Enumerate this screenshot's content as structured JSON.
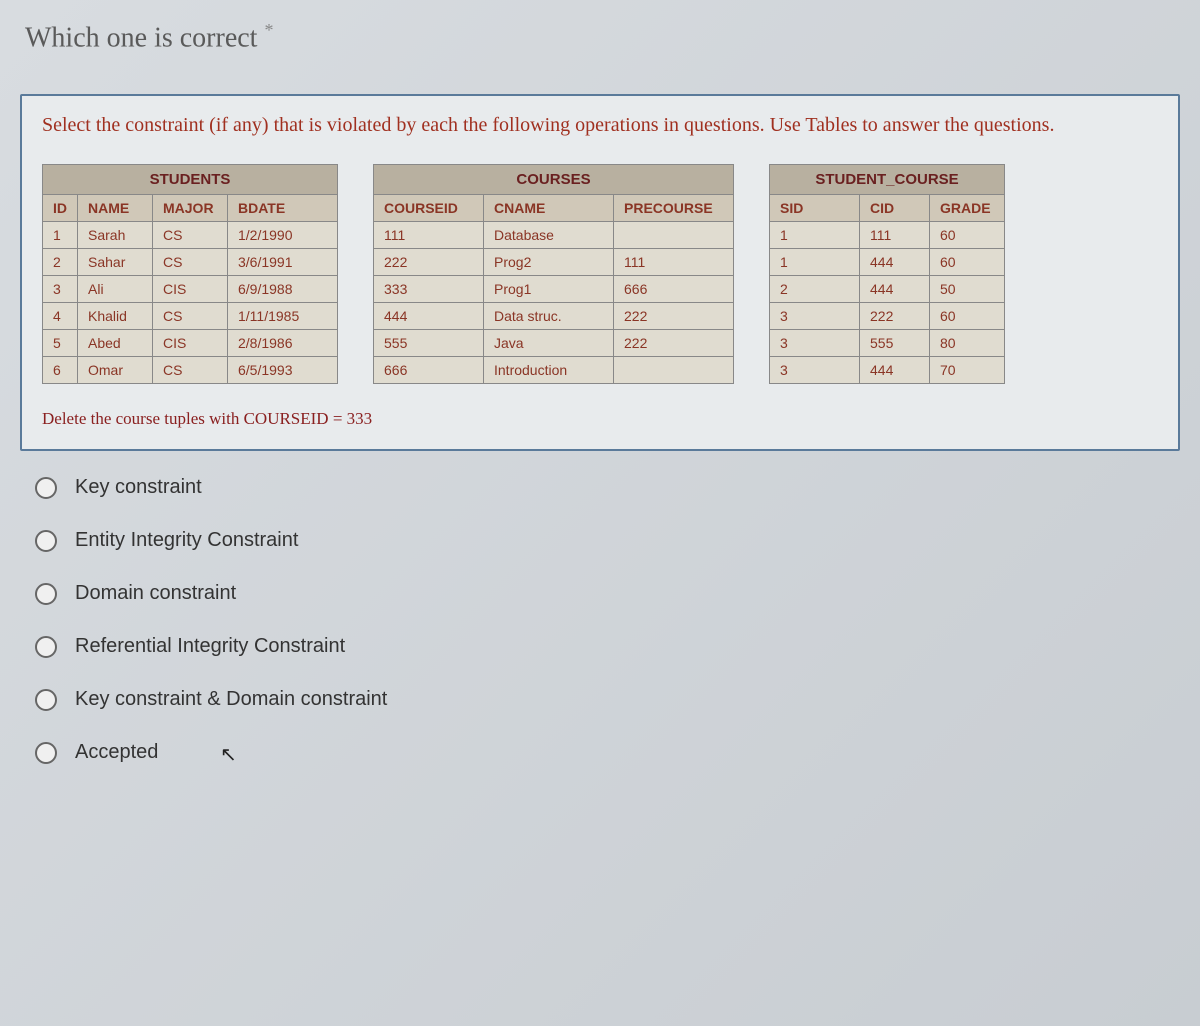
{
  "title": "Which one is correct",
  "instruction": "Select the constraint (if any) that is violated by each the following operations in questions. Use Tables to answer the questions.",
  "tables": {
    "students": {
      "title": "STUDENTS",
      "headers": [
        "ID",
        "NAME",
        "MAJOR",
        "BDATE"
      ],
      "rows": [
        [
          "1",
          "Sarah",
          "CS",
          "1/2/1990"
        ],
        [
          "2",
          "Sahar",
          "CS",
          "3/6/1991"
        ],
        [
          "3",
          "Ali",
          "CIS",
          "6/9/1988"
        ],
        [
          "4",
          "Khalid",
          "CS",
          "1/11/1985"
        ],
        [
          "5",
          "Abed",
          "CIS",
          "2/8/1986"
        ],
        [
          "6",
          "Omar",
          "CS",
          "6/5/1993"
        ]
      ]
    },
    "courses": {
      "title": "COURSES",
      "headers": [
        "COURSEID",
        "CNAME",
        "PRECOURSE"
      ],
      "rows": [
        [
          "111",
          "Database",
          ""
        ],
        [
          "222",
          "Prog2",
          "111"
        ],
        [
          "333",
          "Prog1",
          "666"
        ],
        [
          "444",
          "Data struc.",
          "222"
        ],
        [
          "555",
          "Java",
          "222"
        ],
        [
          "666",
          "Introduction",
          ""
        ]
      ]
    },
    "student_course": {
      "title": "STUDENT_COURSE",
      "headers": [
        "SID",
        "CID",
        "GRADE"
      ],
      "rows": [
        [
          "1",
          "111",
          "60"
        ],
        [
          "1",
          "444",
          "60"
        ],
        [
          "2",
          "444",
          "50"
        ],
        [
          "3",
          "222",
          "60"
        ],
        [
          "3",
          "555",
          "80"
        ],
        [
          "3",
          "444",
          "70"
        ]
      ]
    }
  },
  "operation": "Delete the  course  tuples  with COURSEID = 333",
  "options": [
    "Key constraint",
    "Entity Integrity Constraint",
    "Domain constraint",
    "Referential Integrity Constraint",
    "Key constraint & Domain constraint",
    "Accepted"
  ]
}
